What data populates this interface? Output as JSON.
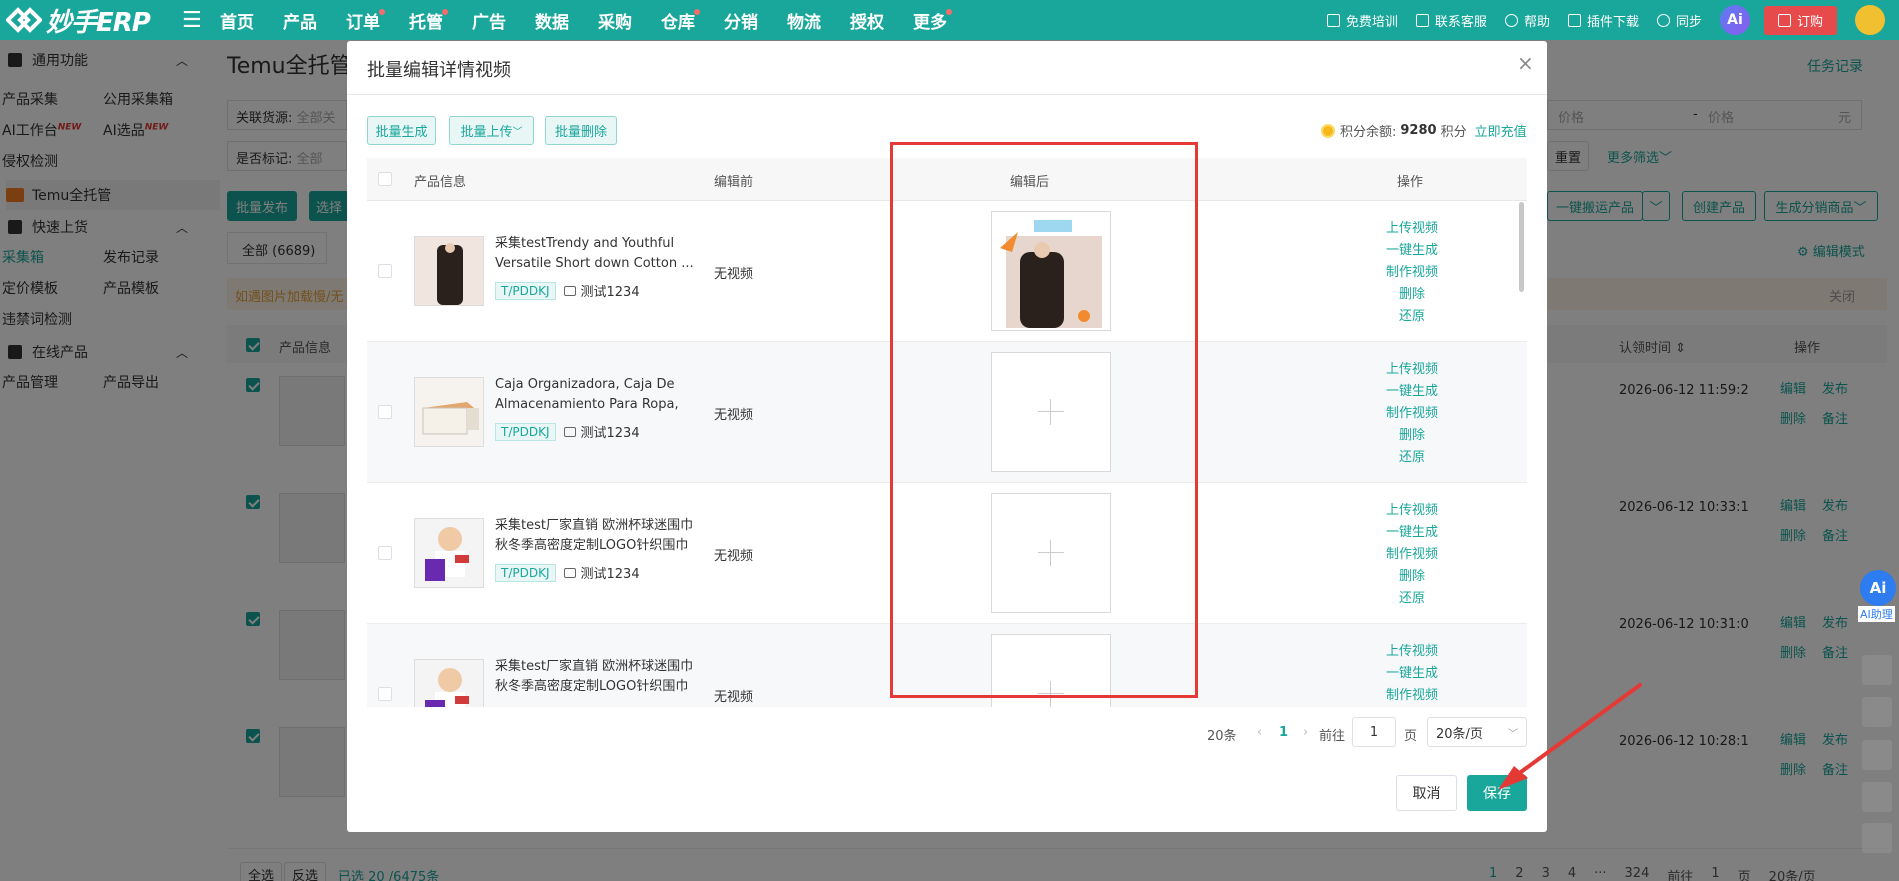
{
  "app": {
    "logo_text": "妙手ERP",
    "nav": [
      {
        "label": "首页",
        "dot": false
      },
      {
        "label": "产品",
        "dot": false
      },
      {
        "label": "订单",
        "dot": true
      },
      {
        "label": "托管",
        "dot": true
      },
      {
        "label": "广告",
        "dot": false
      },
      {
        "label": "数据",
        "dot": false
      },
      {
        "label": "采购",
        "dot": false
      },
      {
        "label": "仓库",
        "dot": true
      },
      {
        "label": "分销",
        "dot": false
      },
      {
        "label": "物流",
        "dot": false
      },
      {
        "label": "授权",
        "dot": false
      },
      {
        "label": "更多",
        "dot": true
      }
    ],
    "right": {
      "training": "免费培训",
      "support": "联系客服",
      "help": "帮助",
      "plugin": "插件下载",
      "sync": "同步",
      "ai": "Ai",
      "order": "订购"
    }
  },
  "sidebar": {
    "sec1": "通用功能",
    "items1": [
      "产品采集",
      "公用采集箱",
      "AI工作台",
      "AI选品",
      "侵权检测"
    ],
    "new_badge": "NEW",
    "temu": "Temu全托管",
    "sec2": "快速上货",
    "items2": [
      "采集箱",
      "发布记录",
      "定价模板",
      "产品模板",
      "违禁词检测"
    ],
    "sec3": "在线产品",
    "items3": [
      "产品管理",
      "产品导出"
    ]
  },
  "background": {
    "title": "Temu全托管",
    "task_link": "任务记录",
    "filter_source": "关联货源:",
    "filter_source_val": "全部关",
    "filter_mark": "是否标记:",
    "filter_mark_val": "全部",
    "price_min": "价格",
    "price_dash": "-",
    "price_max": "价格",
    "price_unit": "元",
    "reset": "重置",
    "more_filter": "更多筛选",
    "batch_publish": "批量发布",
    "select": "选择",
    "one_click": "一键搬运产品",
    "create": "创建产品",
    "gen_dist": "生成分销商品",
    "edit_mode": "编辑模式",
    "tab_all": "全部 (6689)",
    "notice": "如遇图片加载慢/无",
    "notice_close": "关闭",
    "col_product": "产品信息",
    "col_claim": "认领时间",
    "col_ops": "操作",
    "rows": [
      {
        "time": "2026-06-12 11:59:2"
      },
      {
        "time": "2026-06-12 10:33:1"
      },
      {
        "time": "2026-06-12 10:31:0"
      },
      {
        "time": "2026-06-12 10:28:1"
      }
    ],
    "op_edit": "编辑",
    "op_publish": "发布",
    "op_delete": "删除",
    "op_note": "备注",
    "footer_all": "全选",
    "footer_inverse": "反选",
    "footer_selected": "已选 20 /6475条",
    "footer_pages": [
      "1",
      "2",
      "3",
      "4",
      "···",
      "324"
    ],
    "footer_goto": "前往",
    "footer_page_val": "1",
    "footer_page": "页",
    "footer_size": "20条/页"
  },
  "modal": {
    "title": "批量编辑详情视频",
    "btn_gen": "批量生成",
    "btn_upload": "批量上传",
    "btn_delete": "批量删除",
    "points_label": "积分余额:",
    "points_value": "9280",
    "points_unit": "积分",
    "recharge": "立即充值",
    "headers": {
      "product": "产品信息",
      "before": "编辑前",
      "after": "编辑后",
      "ops": "操作"
    },
    "ops": [
      "上传视频",
      "一键生成",
      "制作视频",
      "删除",
      "还原"
    ],
    "rows": [
      {
        "title": "采集testTrendy and Youthful Versatile Short down Cotton ...",
        "tag": "T/PDDKJ",
        "shop": "测试1234",
        "before": "无视频",
        "has_video": true
      },
      {
        "title": "Caja Organizadora, Caja De Almacenamiento Para Ropa, ...",
        "tag": "T/PDDKJ",
        "shop": "测试1234",
        "before": "无视频",
        "has_video": false
      },
      {
        "title": "采集test厂家直销 欧洲杯球迷围巾秋冬季高密度定制LOGO针织围巾",
        "tag": "T/PDDKJ",
        "shop": "测试1234",
        "before": "无视频",
        "has_video": false
      },
      {
        "title": "采集test厂家直销 欧洲杯球迷围巾秋冬季高密度定制LOGO针织围巾",
        "tag": "",
        "shop": "",
        "before": "无视频",
        "has_video": false
      }
    ],
    "pager": {
      "total": "20条",
      "current": "1",
      "goto": "前往",
      "page_val": "1",
      "page": "页",
      "size": "20条/页"
    },
    "cancel": "取消",
    "save": "保存"
  },
  "float": {
    "ai": "Ai",
    "ai_label": "AI助理"
  },
  "colors": {
    "brand": "#1aa79b",
    "highlight": "#e53935",
    "arrow": "#e53935"
  }
}
